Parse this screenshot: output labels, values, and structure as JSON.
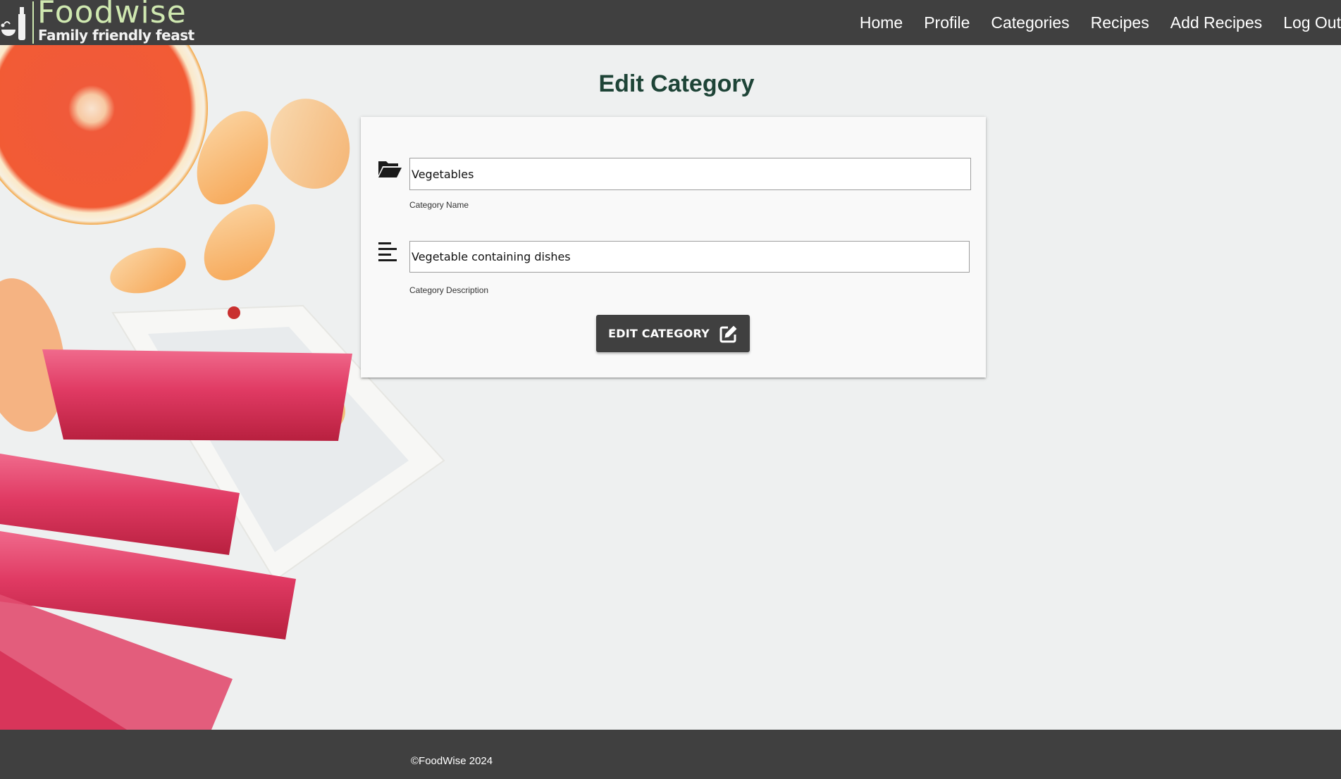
{
  "brand": {
    "name": "Foodwise",
    "tagline": "Family friendly feast"
  },
  "nav": {
    "items": [
      {
        "label": "Home"
      },
      {
        "label": "Profile"
      },
      {
        "label": "Categories"
      },
      {
        "label": "Recipes"
      },
      {
        "label": "Add Recipes"
      },
      {
        "label": "Log Out"
      }
    ]
  },
  "page": {
    "title": "Edit Category"
  },
  "form": {
    "category_name": {
      "value": "Vegetables",
      "label": "Category Name",
      "icon": "folder-open-icon"
    },
    "category_description": {
      "value": "Vegetable containing dishes",
      "label": "Category Description",
      "icon": "align-left-icon"
    },
    "submit_label": "EDIT CATEGORY",
    "submit_icon": "edit-icon"
  },
  "footer": {
    "copyright": "©FoodWise 2024"
  },
  "colors": {
    "navbar": "#404040",
    "brand_green": "#cfe8b0",
    "title_green": "#1e4437",
    "button": "#404040"
  }
}
